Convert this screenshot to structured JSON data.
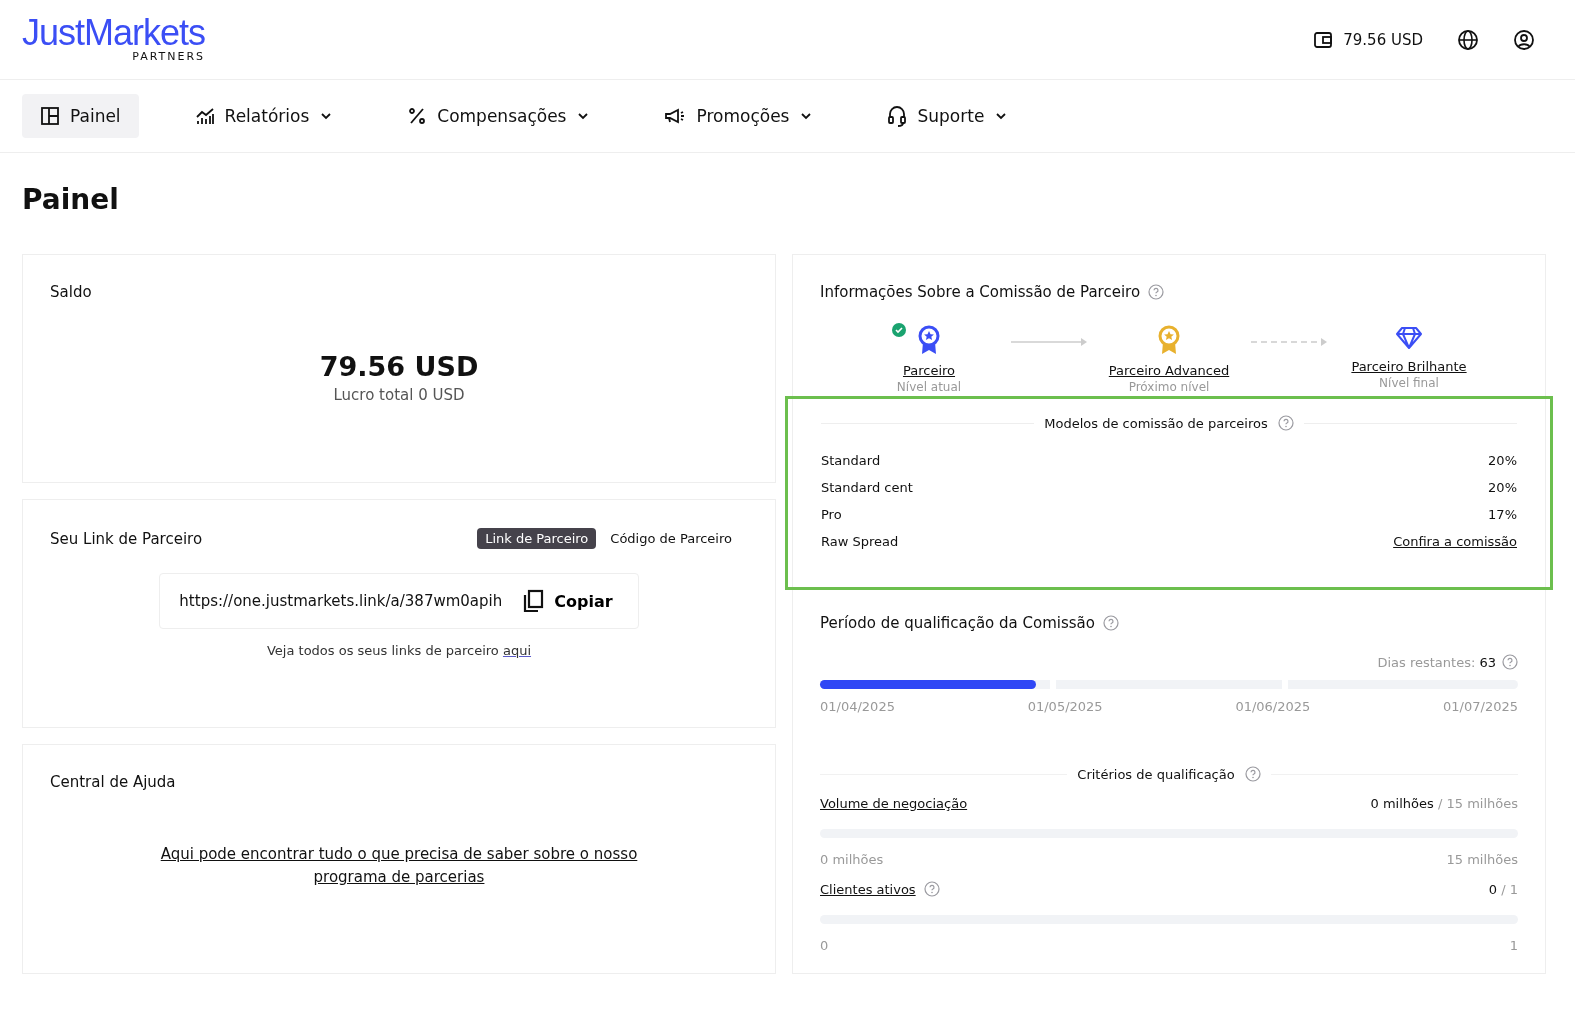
{
  "header": {
    "logo": {
      "brand": "JustMarkets",
      "sub": "PARTNERS"
    },
    "balance": "79.56 USD"
  },
  "nav": [
    {
      "label": "Painel",
      "dropdown": false,
      "selected": true
    },
    {
      "label": "Relatórios",
      "dropdown": true,
      "selected": false
    },
    {
      "label": "Compensações",
      "dropdown": true,
      "selected": false
    },
    {
      "label": "Promoções",
      "dropdown": true,
      "selected": false
    },
    {
      "label": "Suporte",
      "dropdown": true,
      "selected": false
    }
  ],
  "page_title": "Painel",
  "balance_card": {
    "title": "Saldo",
    "amount": "79.56 USD",
    "profit": "Lucro total 0 USD"
  },
  "link_card": {
    "title": "Seu Link de Parceiro",
    "tabs": [
      {
        "label": "Link de Parceiro",
        "selected": true
      },
      {
        "label": "Código de Parceiro",
        "selected": false
      }
    ],
    "link": "https://one.justmarkets.link/a/387wm0apih",
    "copy": "Copiar",
    "note": "Veja todos os seus links de parceiro",
    "note_link": "aqui"
  },
  "help_card": {
    "title": "Central de Ajuda",
    "link": "Aqui pode encontrar tudo o que precisa de saber sobre o nosso programa de parcerias"
  },
  "commission": {
    "title": "Informações Sobre a Comissão de Parceiro",
    "levels": [
      {
        "name": "Parceiro",
        "caption": "Nível atual",
        "current": true
      },
      {
        "name": "Parceiro Advanced",
        "caption": "Próximo nível",
        "current": false
      },
      {
        "name": "Parceiro Brilhante",
        "caption": "Nível final",
        "current": false
      }
    ],
    "models": {
      "title": "Modelos de comissão de parceiros",
      "highlighted": true,
      "rows": [
        {
          "name": "Standard",
          "value": "20%",
          "kind": "text"
        },
        {
          "name": "Standard cent",
          "value": "20%",
          "kind": "text"
        },
        {
          "name": "Pro",
          "value": "17%",
          "kind": "text"
        },
        {
          "name": "Raw Spread",
          "value": "Confira a comissão",
          "kind": "link"
        }
      ]
    }
  },
  "period": {
    "title": "Período de qualificação da Comissão",
    "days_label": "Dias restantes:",
    "days": "63",
    "progress": {
      "level": 0.31
    },
    "dates": [
      "01/04/2025",
      "01/05/2025",
      "01/06/2025",
      "01/07/2025"
    ],
    "criteria_title": "Critérios de qualificação",
    "criteria": [
      {
        "name": "Volume de negociação",
        "help": false,
        "current": "0 milhões",
        "target": "/ 15 milhões",
        "min": "0 milhões",
        "max": "15 milhões"
      },
      {
        "name": "Clientes ativos",
        "help": true,
        "current": "0",
        "target": "/ 1",
        "min": "0",
        "max": "1"
      }
    ]
  }
}
